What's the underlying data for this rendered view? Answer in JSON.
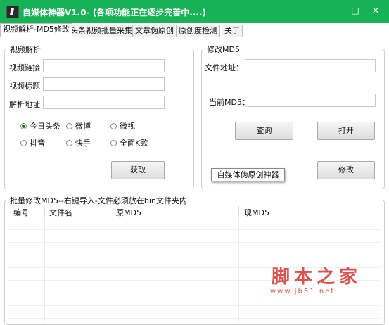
{
  "window": {
    "title": "自媒体神器V1.0- (各项功能正在逐步完善中....)",
    "minimize": "—",
    "maximize": "□",
    "close": "✕",
    "titlebar_color": "#16b255"
  },
  "tabs": [
    {
      "label": "视频解析-MD5修改",
      "active": true
    },
    {
      "label": "头条视频批量采集",
      "active": false
    },
    {
      "label": "文章伪原创",
      "active": false
    },
    {
      "label": "原创度检测",
      "active": false
    },
    {
      "label": "关于",
      "active": false
    }
  ],
  "video_parse": {
    "legend": "视频解析",
    "link_label": "视频链接",
    "title_label": "视频标题",
    "address_label": "解析地址",
    "link_value": "",
    "title_value": "",
    "address_value": "",
    "platforms": [
      {
        "label": "今日头条",
        "selected": true
      },
      {
        "label": "微博",
        "selected": false
      },
      {
        "label": "微视",
        "selected": false
      },
      {
        "label": "抖音",
        "selected": false
      },
      {
        "label": "快手",
        "selected": false
      },
      {
        "label": "全面K歌",
        "selected": false
      }
    ],
    "fetch_button": "获取"
  },
  "md5_edit": {
    "legend": "修改MD5",
    "file_label": "文件地址：",
    "current_label": "当前MD5：",
    "file_value": "",
    "current_value": "",
    "query_button": "查询",
    "open_button": "打开",
    "modify_button": "修改",
    "tooltip": "自媒体伪原创神器"
  },
  "batch": {
    "legend": "批量修改MD5--右键导入-文件必须放在bin文件夹内",
    "columns": [
      "编号",
      "文件名",
      "原MD5",
      "现MD5"
    ],
    "rows": []
  },
  "watermark": {
    "title": "脚本之家",
    "url": "www.jb51.net",
    "color": "#d9534f"
  }
}
